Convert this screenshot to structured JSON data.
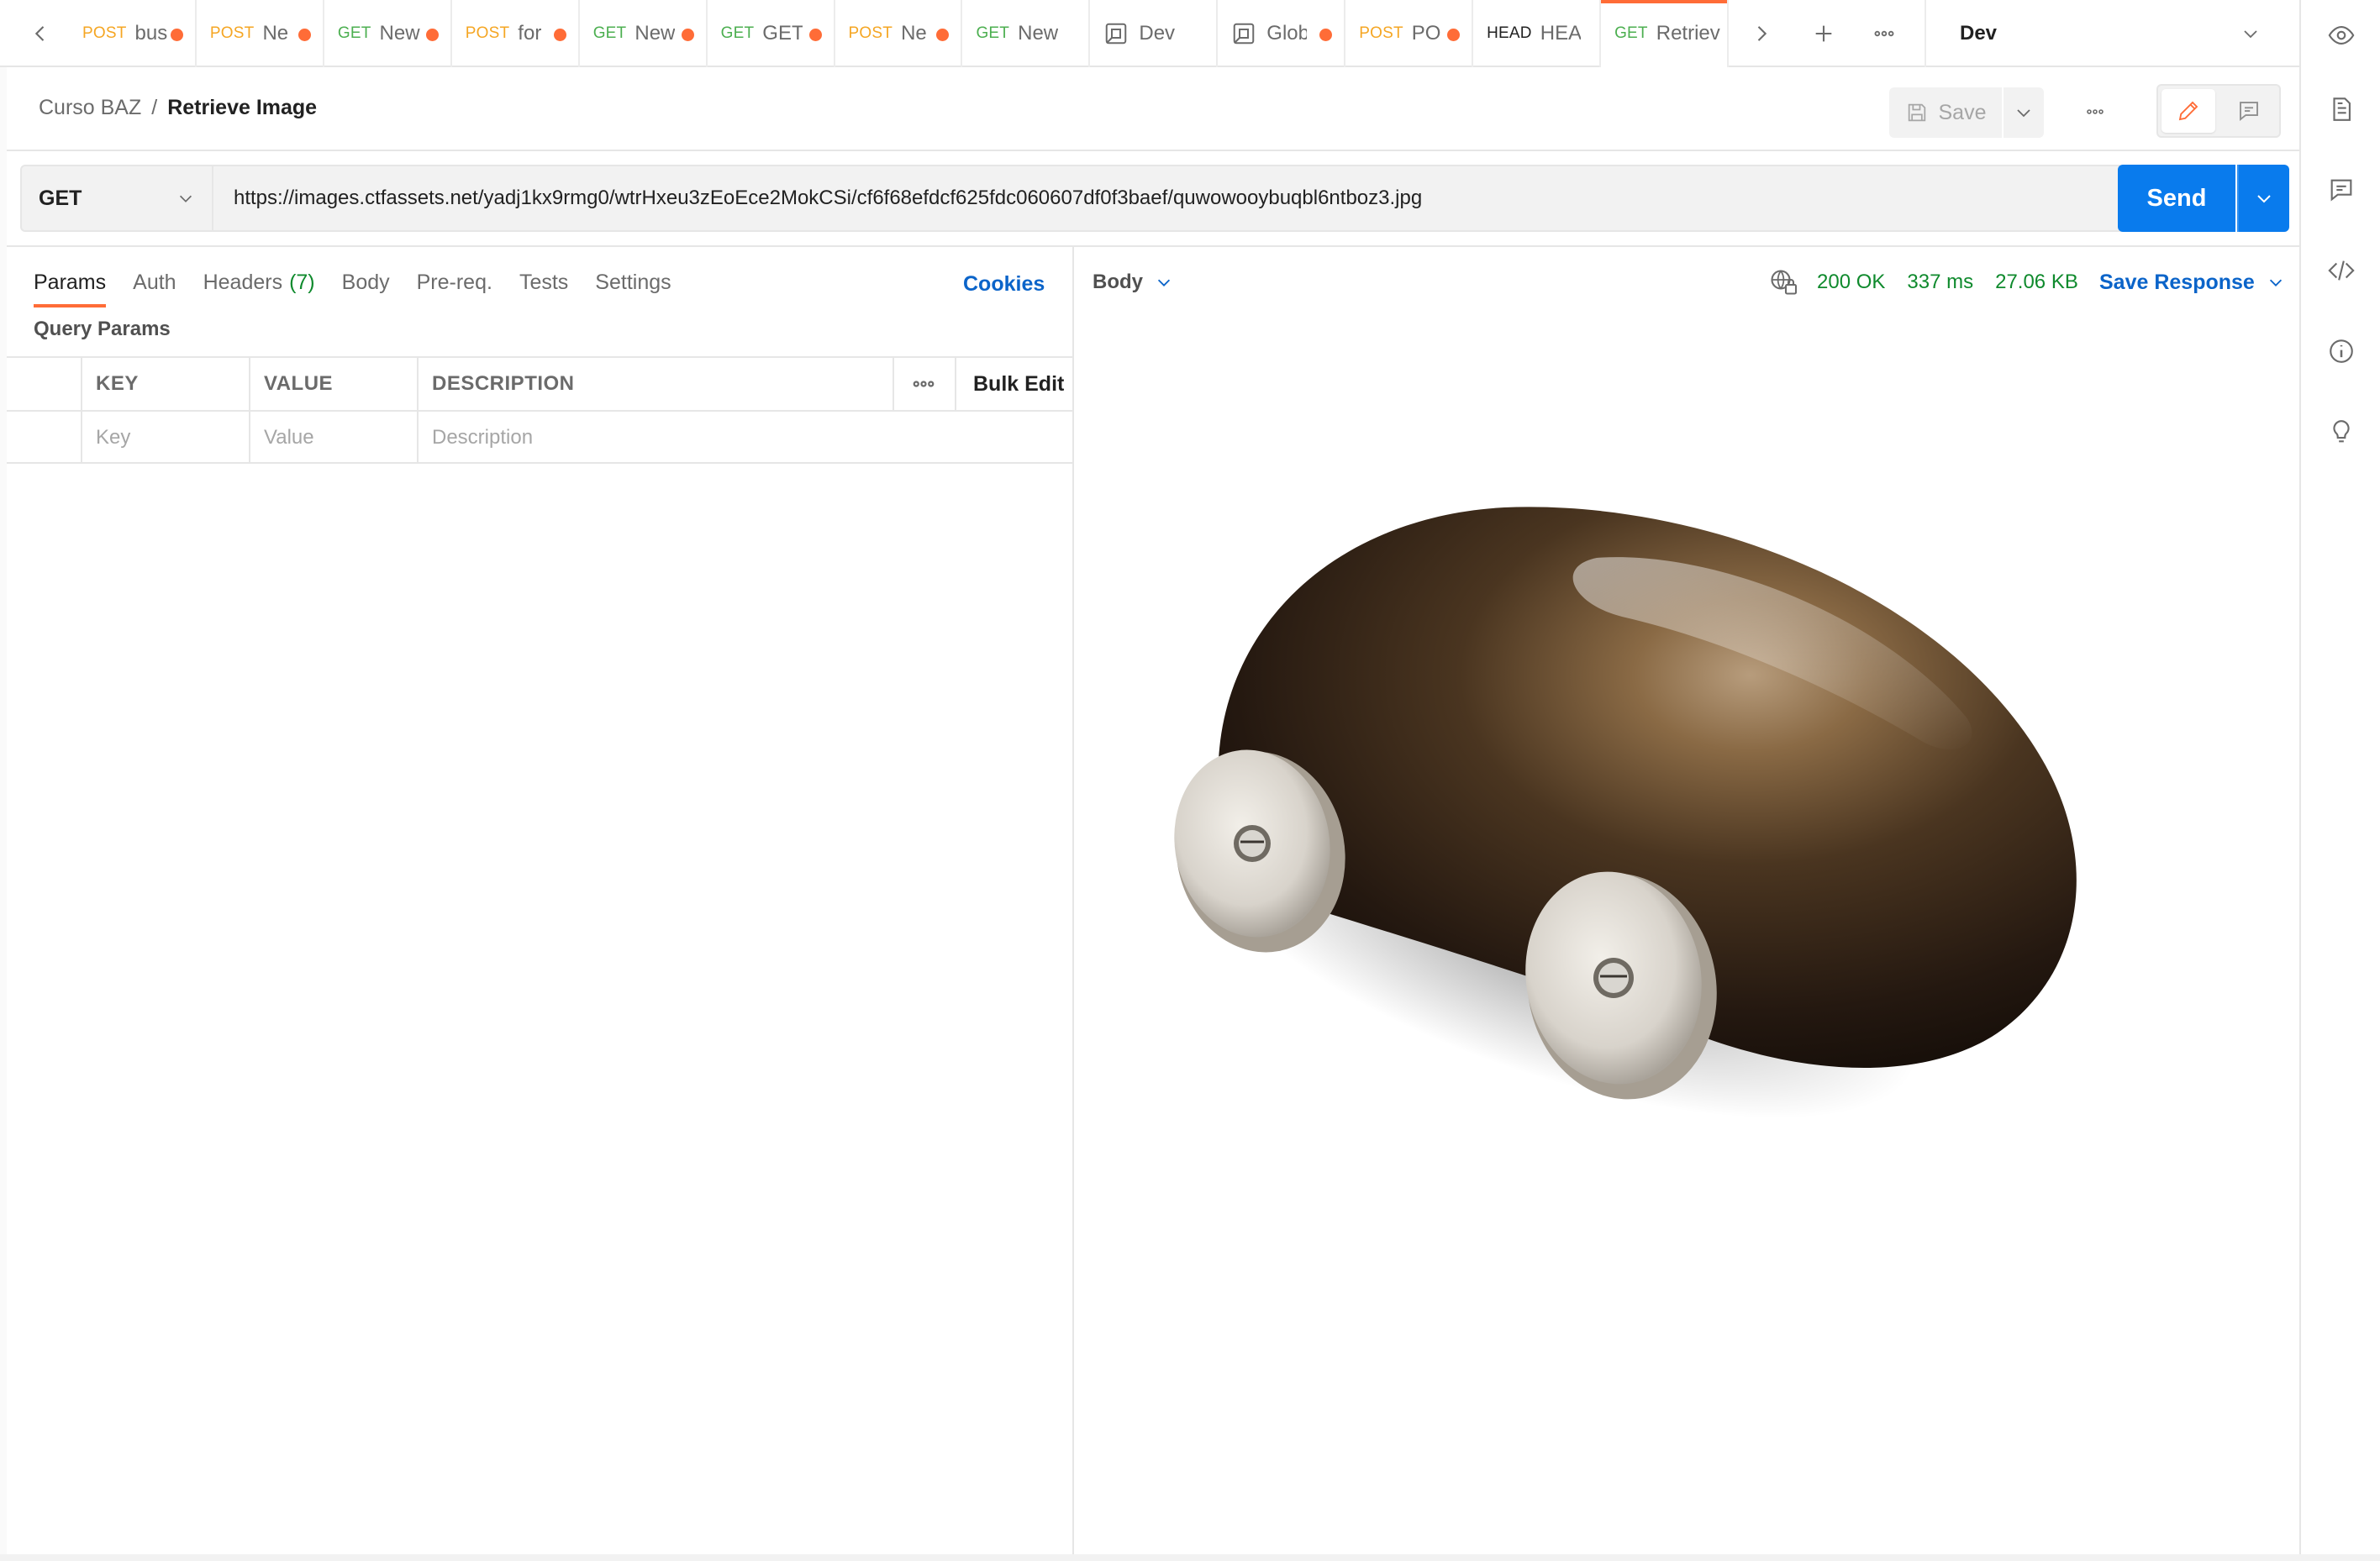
{
  "tabs": [
    {
      "method": "POST",
      "name": "bus",
      "unsaved": true
    },
    {
      "method": "POST",
      "name": "Ne",
      "unsaved": true
    },
    {
      "method": "GET",
      "name": "New",
      "unsaved": true
    },
    {
      "method": "POST",
      "name": "for",
      "unsaved": true
    },
    {
      "method": "GET",
      "name": "New",
      "unsaved": true
    },
    {
      "method": "GET",
      "name": "GET",
      "unsaved": true
    },
    {
      "method": "POST",
      "name": "Ne",
      "unsaved": true
    },
    {
      "method": "GET",
      "name": "New R",
      "unsaved": false
    },
    {
      "method": "",
      "name": "Dev",
      "unsaved": false,
      "icon": "environment-icon"
    },
    {
      "method": "",
      "name": "Glob",
      "unsaved": true,
      "icon": "environment-icon"
    },
    {
      "method": "POST",
      "name": "PO",
      "unsaved": true
    },
    {
      "method": "HEAD",
      "name": "HEAD",
      "unsaved": false
    },
    {
      "method": "GET",
      "name": "Retriev",
      "unsaved": false,
      "active": true
    }
  ],
  "environment": {
    "selected": "Dev"
  },
  "breadcrumb": {
    "collection": "Curso BAZ",
    "separator": "/",
    "request": "Retrieve Image"
  },
  "header": {
    "save_label": "Save"
  },
  "request": {
    "method": "GET",
    "url": "https://images.ctfassets.net/yadj1kx9rmg0/wtrHxeu3zEoEce2MokCSi/cf6f68efdcf625fdc060607df0f3baef/quwowooybuqbl6ntboz3.jpg",
    "send_label": "Send"
  },
  "request_tabs": {
    "params": "Params",
    "auth": "Auth",
    "headers": "Headers",
    "headers_count": "(7)",
    "body": "Body",
    "prereq": "Pre-req.",
    "tests": "Tests",
    "settings": "Settings",
    "cookies": "Cookies"
  },
  "query_params": {
    "title": "Query Params",
    "columns": {
      "key": "KEY",
      "value": "VALUE",
      "description": "DESCRIPTION"
    },
    "bulk_edit": "Bulk Edit",
    "placeholders": {
      "key": "Key",
      "value": "Value",
      "description": "Description"
    }
  },
  "response": {
    "view": "Body",
    "status": "200 OK",
    "time": "337 ms",
    "size": "27.06 KB",
    "save_label": "Save Response"
  },
  "colors": {
    "accent": "#ff6c37",
    "primary": "#097bed",
    "success": "#0f8a2d",
    "link": "#0b64c9"
  }
}
